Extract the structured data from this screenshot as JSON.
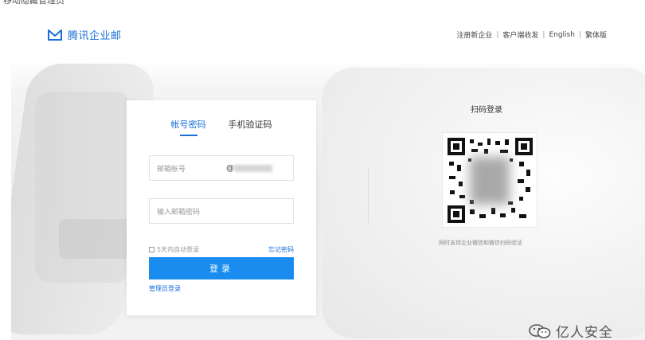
{
  "caption": "移动隐藏管理员",
  "header": {
    "logo_text": "腾讯企业邮",
    "links": [
      "注册新企业",
      "客户端收发",
      "English",
      "繁体版"
    ],
    "separator": "|"
  },
  "login": {
    "tabs": [
      {
        "label": "帐号密码",
        "active": true
      },
      {
        "label": "手机验证码",
        "active": false
      }
    ],
    "email_placeholder": "邮箱帐号",
    "email_at": "@",
    "password_placeholder": "输入邮箱密码",
    "remember_label": "5天内自动登录",
    "forgot_label": "忘记密码",
    "submit_label": "登录",
    "admin_label": "管理员登录"
  },
  "qr": {
    "title": "扫码登录",
    "caption": "同时支持企业微信和微信扫码验证"
  },
  "watermark": {
    "text": "亿人安全"
  },
  "colors": {
    "accent": "#1a6fd8",
    "button": "#1a8cf0"
  }
}
